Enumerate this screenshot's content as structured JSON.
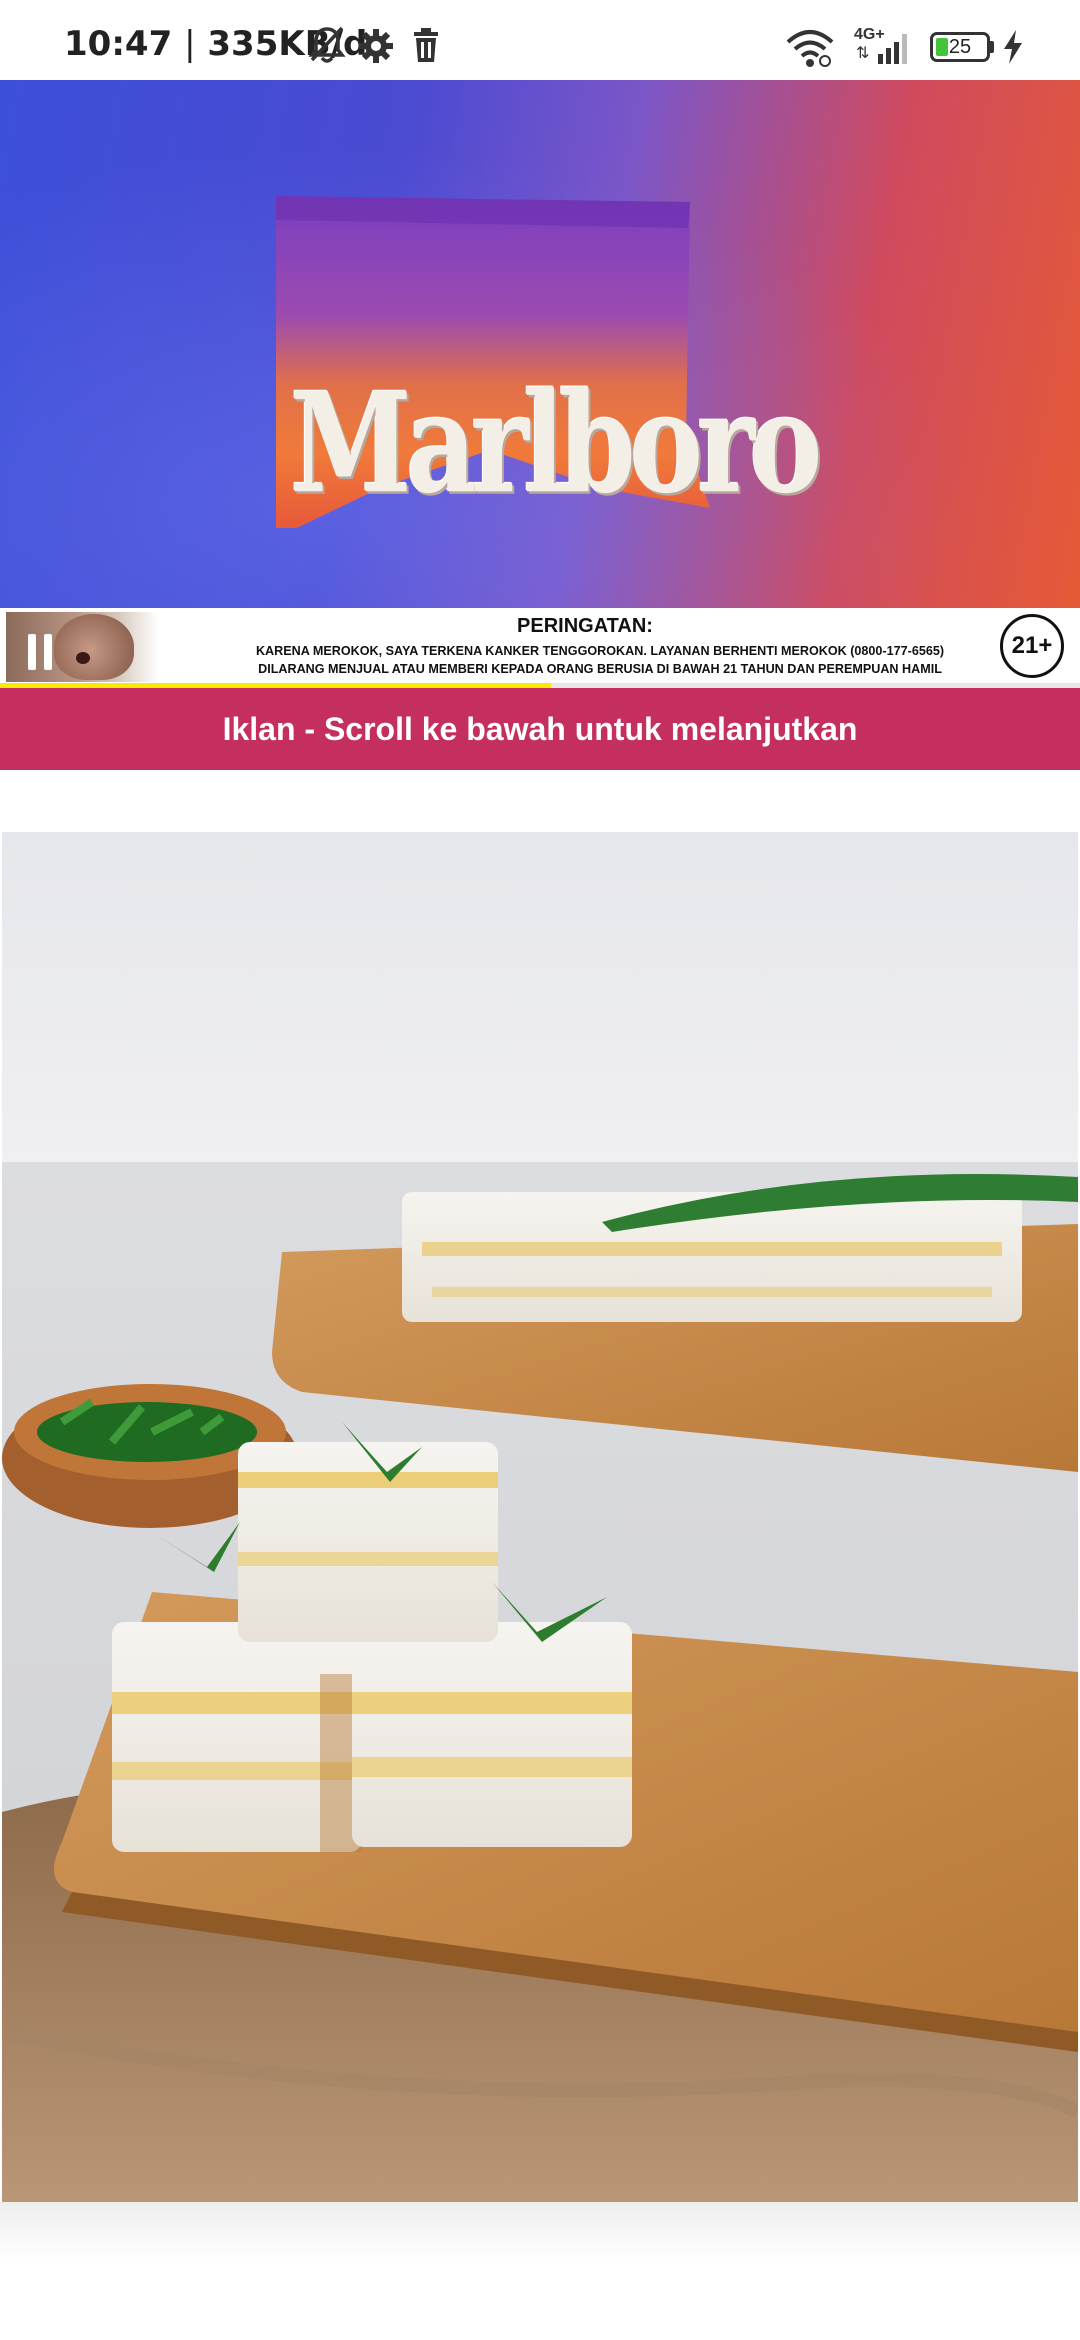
{
  "status_bar": {
    "time": "10:47",
    "data_rate": "335KB/d",
    "network_type": "4G+",
    "battery_level": "25",
    "icons": [
      "bell-muted-icon",
      "gear-icon",
      "trash-icon",
      "wifi-icon",
      "cellular-signal-icon",
      "battery-icon",
      "charging-bolt-icon"
    ]
  },
  "ad": {
    "brand": "Marlboro",
    "warning_title": "PERINGATAN:",
    "warning_line_1": "KARENA MEROKOK, SAYA TERKENA KANKER TENGGOROKAN. LAYANAN BERHENTI MEROKOK (0800-177-6565)",
    "warning_line_2": "DILARANG MENJUAL ATAU MEMBERI KEPADA ORANG BERUSIA DI BAWAH 21 TAHUN DAN PEREMPUAN HAMIL",
    "age_badge": "21+",
    "video_progress": 0.51,
    "colors": {
      "gradient_left": "#3d4fd8",
      "gradient_right": "#e55a36",
      "progress_fill": "#ffe800"
    }
  },
  "scroll_banner": {
    "text": "Iklan - Scroll ke bawah untuk melanjutkan",
    "color": "#c42f5e"
  },
  "article_image": {
    "icon": "food-photo-image"
  }
}
